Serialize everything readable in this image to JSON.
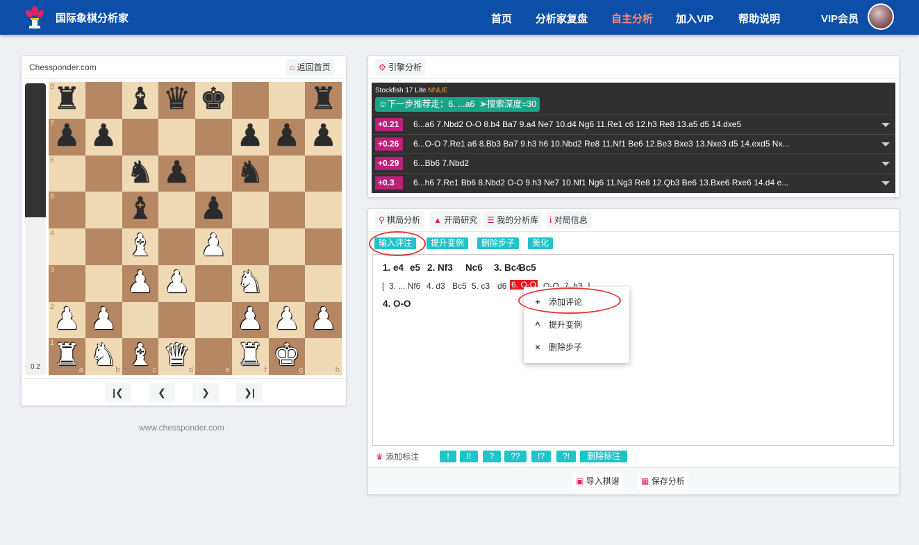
{
  "header": {
    "brand": "国际象棋分析家",
    "nav": [
      {
        "label": "首页",
        "active": false
      },
      {
        "label": "分析家复盘",
        "active": false
      },
      {
        "label": "自主分析",
        "active": true
      },
      {
        "label": "加入VIP",
        "active": false
      },
      {
        "label": "帮助说明",
        "active": false
      },
      {
        "label": "VIP会员",
        "active": false
      }
    ]
  },
  "board_panel": {
    "site": "Chessponder.com",
    "home_button": "返回首页",
    "eval_value": "0.2",
    "eval_black_fraction": 0.46,
    "ranks": [
      "8",
      "7",
      "6",
      "5",
      "4",
      "3",
      "2",
      "1"
    ],
    "files": [
      "a",
      "b",
      "c",
      "d",
      "e",
      "f",
      "g",
      "h"
    ],
    "position": [
      [
        "br",
        "",
        "bb",
        "bq",
        "bk",
        "",
        "",
        "br"
      ],
      [
        "bp",
        "bp",
        "",
        "",
        "",
        "bp",
        "bp",
        "bp"
      ],
      [
        "",
        "",
        "bn",
        "bp",
        "",
        "bn",
        "",
        ""
      ],
      [
        "",
        "",
        "bb",
        "",
        "bp",
        "",
        "",
        ""
      ],
      [
        "",
        "",
        "wb",
        "",
        "wp",
        "",
        "",
        ""
      ],
      [
        "",
        "",
        "wp",
        "wp",
        "",
        "wn",
        "",
        ""
      ],
      [
        "wp",
        "wp",
        "",
        "",
        "",
        "wp",
        "wp",
        "wp"
      ],
      [
        "wr",
        "wn",
        "wb",
        "wq",
        "",
        "wr",
        "wk",
        ""
      ]
    ],
    "nav_buttons": [
      "first",
      "prev",
      "next",
      "last"
    ],
    "footer": "www.chessponder.com"
  },
  "engine": {
    "tab_label": "引擎分析",
    "engine_name": "Stockfish 17 Lite",
    "engine_tag": "NNUE",
    "recommend": "下一步推荐走：6. ...a6",
    "depth": "搜索深度=30",
    "lines": [
      {
        "score": "+0.21",
        "pv": "6...a6 7.Nbd2 O-O 8.b4 Ba7 9.a4 Ne7 10.d4 Ng6 11.Re1 c6 12.h3 Re8 13.a5 d5 14.dxe5"
      },
      {
        "score": "+0.26",
        "pv": "6...O-O 7.Re1 a6 8.Bb3 Ba7 9.h3 h6 10.Nbd2 Re8 11.Nf1 Be6 12.Be3 Bxe3 13.Nxe3 d5 14.exd5 Nx..."
      },
      {
        "score": "+0.29",
        "pv": "6...Bb6 7.Nbd2"
      },
      {
        "score": "+0.3",
        "pv": "6...h6 7.Re1 Bb6 8.Nbd2 O-O 9.h3 Ne7 10.Nf1 Ng6 11.Ng3 Re8 12.Qb3 Be6 13.Bxe6 Rxe6 14.d4 e..."
      }
    ]
  },
  "analysis": {
    "tabs": [
      "棋局分析",
      "开局研究",
      "我的分析库",
      "对局信息"
    ],
    "tools": [
      "输入评注",
      "提升变例",
      "删除步子",
      "美化"
    ],
    "main_line": [
      "1. e4",
      "e5",
      "2. Nf3",
      "Nc6",
      "3. Bc4",
      "Bc5"
    ],
    "variation": [
      "[",
      "3. ... Nf6",
      "4. d3",
      "Bc5",
      "5. c3",
      "d6",
      "6. O-O",
      "O-O",
      "7. h3",
      "]"
    ],
    "highlighted_move": "6. O-O",
    "after_var": "4. O-O",
    "context_menu": [
      {
        "icon": "+",
        "label": "添加评论"
      },
      {
        "icon": "^",
        "label": "提升变例"
      },
      {
        "icon": "×",
        "label": "删除步子"
      }
    ],
    "annot_label": "添加标注",
    "annot_buttons": [
      "!",
      "!!",
      "?",
      "??",
      "!?",
      "?!",
      "删除标注"
    ],
    "import_button": "导入棋谱",
    "save_button": "保存分析"
  }
}
